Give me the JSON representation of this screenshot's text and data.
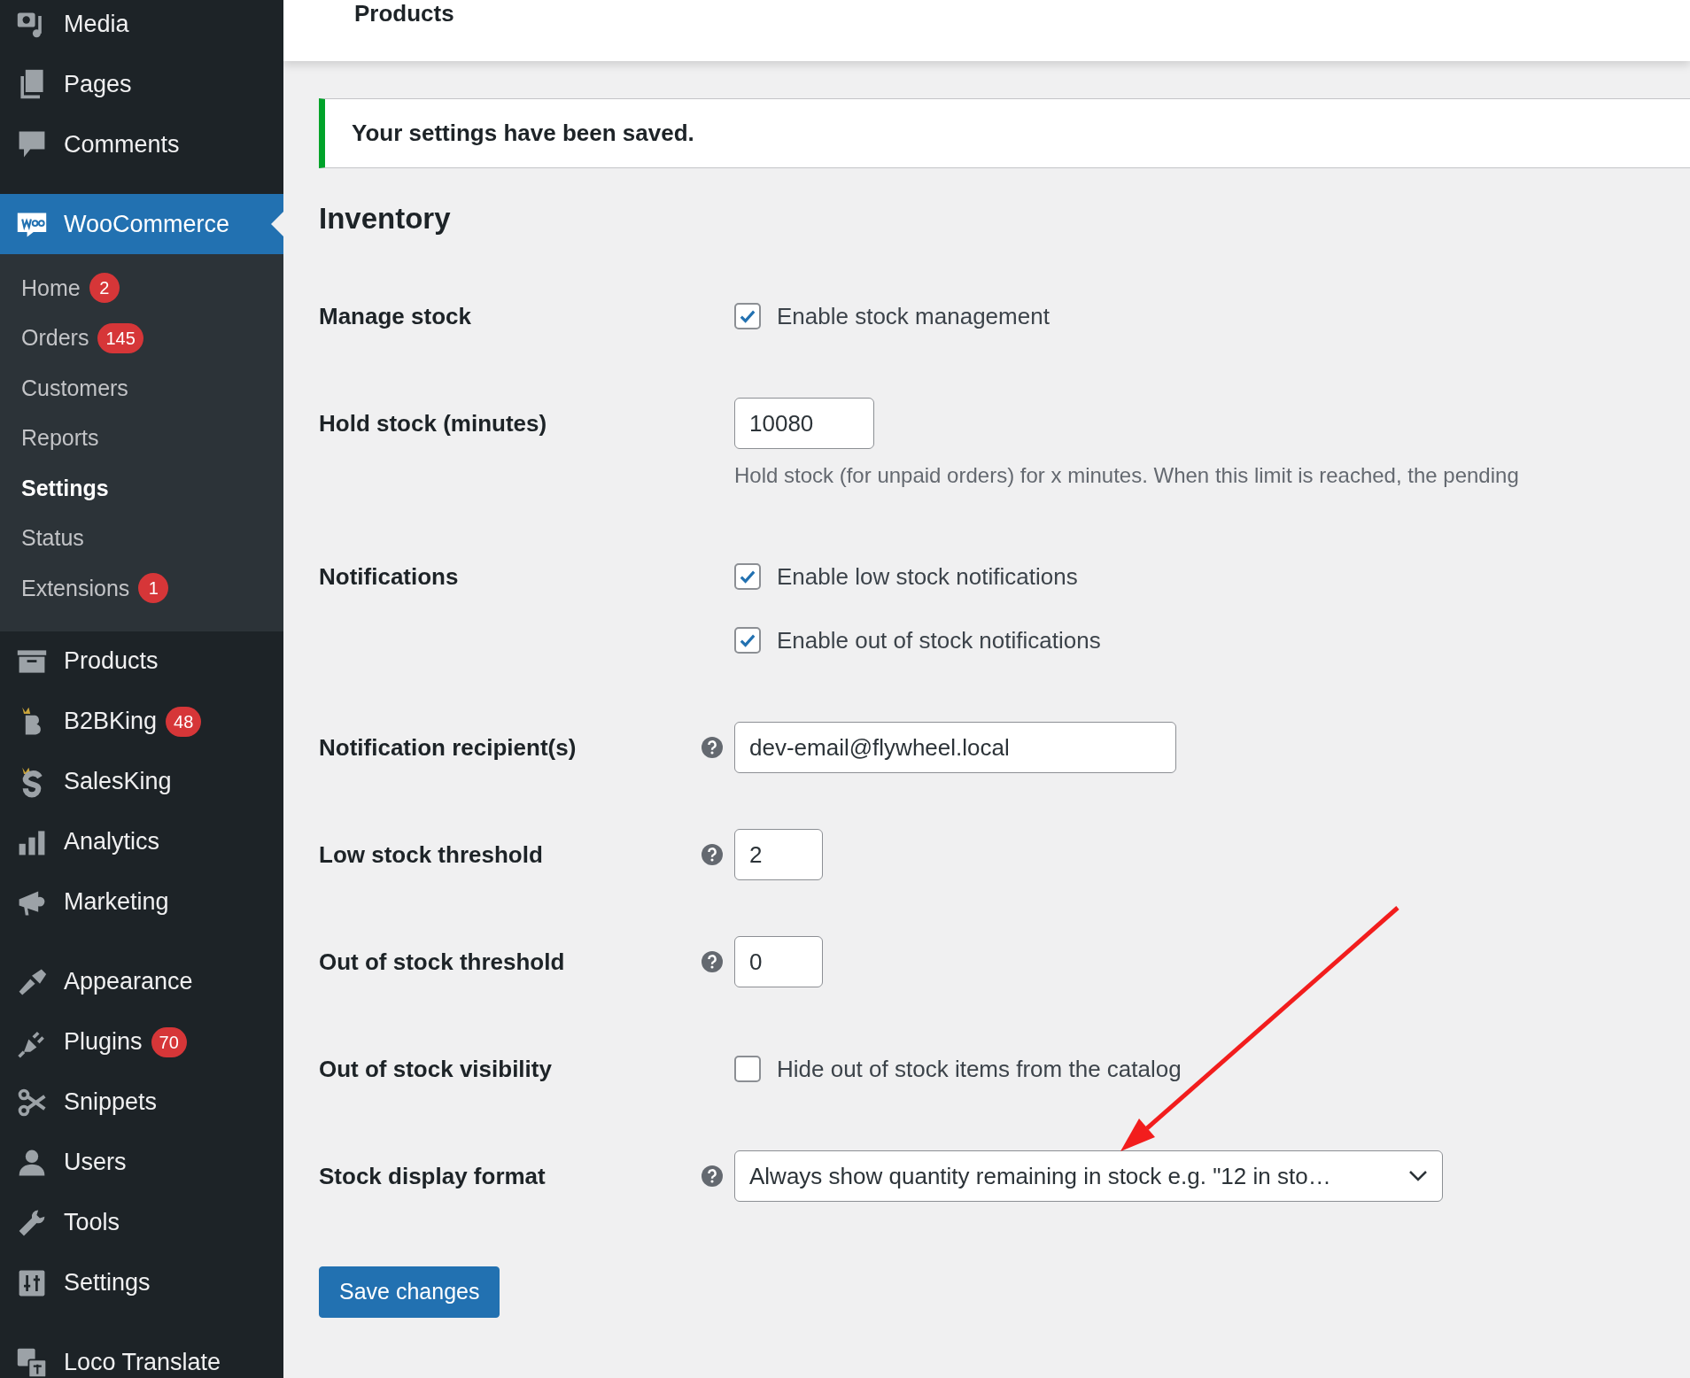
{
  "sidebar": {
    "groups": [
      {
        "items": [
          {
            "label": "Media",
            "selected": false
          },
          {
            "label": "Pages",
            "selected": false
          },
          {
            "label": "Comments",
            "selected": false
          }
        ]
      },
      {
        "items": [
          {
            "label": "WooCommerce",
            "selected": true,
            "children": [
              {
                "label": "Home",
                "badge": "2",
                "selected": false
              },
              {
                "label": "Orders",
                "badge": "145",
                "selected": false
              },
              {
                "label": "Customers",
                "selected": false
              },
              {
                "label": "Reports",
                "selected": false
              },
              {
                "label": "Settings",
                "selected": true
              },
              {
                "label": "Status",
                "selected": false
              },
              {
                "label": "Extensions",
                "badge": "1",
                "selected": false
              }
            ]
          },
          {
            "label": "Products",
            "selected": false
          },
          {
            "label": "B2BKing",
            "badge": "48",
            "selected": false
          },
          {
            "label": "SalesKing",
            "selected": false
          },
          {
            "label": "Analytics",
            "selected": false
          },
          {
            "label": "Marketing",
            "selected": false
          }
        ]
      },
      {
        "items": [
          {
            "label": "Appearance",
            "selected": false
          },
          {
            "label": "Plugins",
            "badge": "70",
            "selected": false
          },
          {
            "label": "Snippets",
            "selected": false
          },
          {
            "label": "Users",
            "selected": false
          },
          {
            "label": "Tools",
            "selected": false
          },
          {
            "label": "Settings",
            "selected": false
          }
        ]
      },
      {
        "items": [
          {
            "label": "Loco Translate",
            "selected": false
          }
        ]
      }
    ]
  },
  "header": {
    "title": "Products"
  },
  "notice": "Your settings have been saved.",
  "heading": "Inventory",
  "rows": [
    {
      "label": "Manage stock",
      "kind": "checkboxes",
      "help": false,
      "options": [
        {
          "label": "Enable stock management",
          "checked": true
        }
      ]
    },
    {
      "label": "Hold stock (minutes)",
      "kind": "input",
      "help": false,
      "value": "10080",
      "description": "Hold stock (for unpaid orders) for x minutes. When this limit is reached, the pending"
    },
    {
      "label": "Notifications",
      "kind": "checkboxes",
      "help": false,
      "options": [
        {
          "label": "Enable low stock notifications",
          "checked": true
        },
        {
          "label": "Enable out of stock notifications",
          "checked": true
        }
      ]
    },
    {
      "label": "Notification recipient(s)",
      "kind": "input",
      "help": true,
      "value": "dev-email@flywheel.local"
    },
    {
      "label": "Low stock threshold",
      "kind": "input",
      "help": true,
      "value": "2"
    },
    {
      "label": "Out of stock threshold",
      "kind": "input",
      "help": true,
      "value": "0"
    },
    {
      "label": "Out of stock visibility",
      "kind": "checkboxes",
      "help": false,
      "options": [
        {
          "label": "Hide out of stock items from the catalog",
          "checked": false
        }
      ]
    },
    {
      "label": "Stock display format",
      "kind": "select",
      "help": true,
      "value": "Always show quantity remaining in stock e.g. \"12 in sto…"
    }
  ],
  "save_button": "Save changes"
}
